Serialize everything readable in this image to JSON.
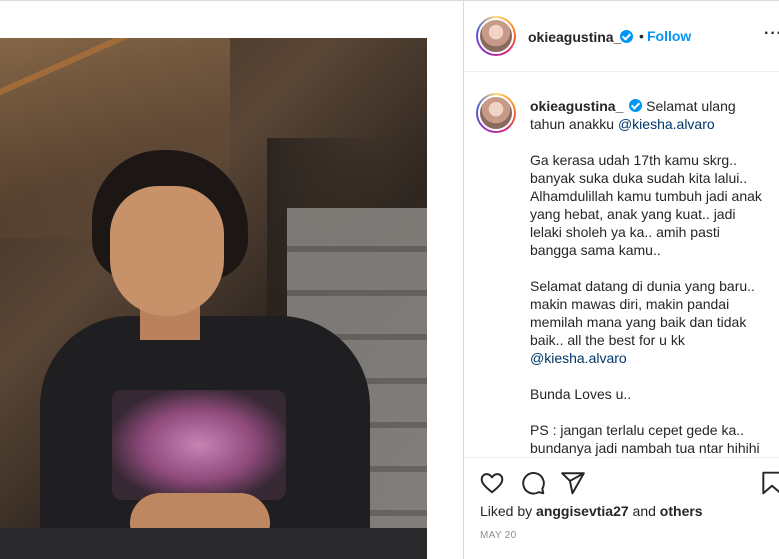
{
  "post": {
    "username": "okieagustina_",
    "follow_label": "Follow",
    "separator": "•",
    "more_label": "···",
    "caption": {
      "first_line": "Selamat ulang tahun anakku",
      "first_mention": "@kiesha.alvaro",
      "para1": "Ga kerasa udah 17th kamu skrg.. banyak suka duka sudah kita lalui.. Alhamdulillah kamu tumbuh jadi anak yang hebat, anak yang kuat.. jadi lelaki sholeh ya ka.. amih pasti bangga sama kamu..",
      "para2": "Selamat datang di dunia yang baru.. makin mawas diri, makin pandai memilah mana yang baik dan tidak baik.. all the best for u kk",
      "para2_mention": "@kiesha.alvaro",
      "para3": "Bunda Loves u..",
      "para4": "PS : jangan terlalu cepet gede ka.. bundanya jadi nambah tua ntar hihihi"
    },
    "likes": {
      "prefix": "Liked by",
      "user": "anggisevtia27",
      "joiner": "and",
      "others": "others"
    },
    "date": "MAY 20"
  },
  "colors": {
    "link_blue": "#0095f6",
    "mention": "#00376b",
    "muted": "#8e8e8e"
  },
  "icons": [
    "heart-icon",
    "comment-icon",
    "share-icon",
    "bookmark-icon",
    "verified-badge-icon"
  ]
}
